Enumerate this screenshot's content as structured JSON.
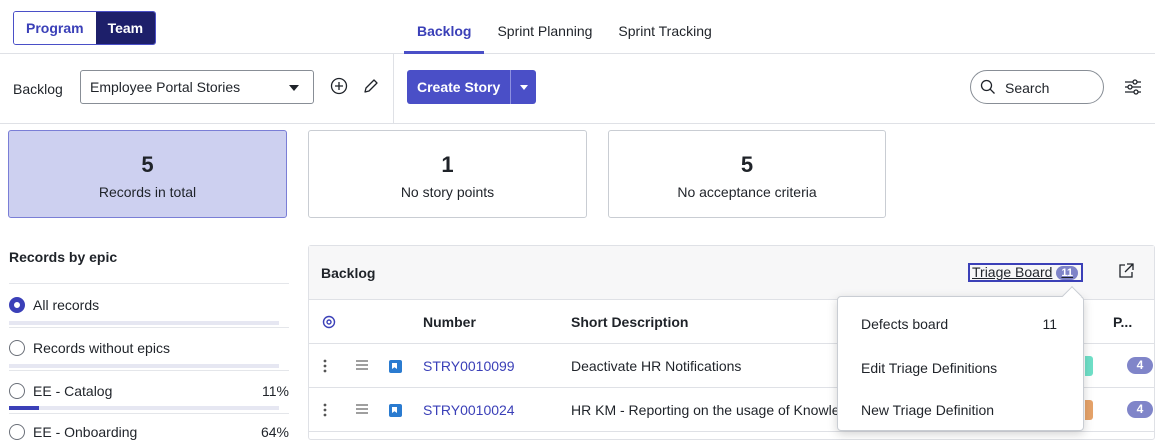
{
  "header": {
    "toggle": [
      {
        "label": "Program",
        "active": false
      },
      {
        "label": "Team",
        "active": true
      }
    ],
    "tabs": [
      {
        "label": "Backlog",
        "active": true
      },
      {
        "label": "Sprint Planning",
        "active": false
      },
      {
        "label": "Sprint Tracking",
        "active": false
      }
    ]
  },
  "toolbar": {
    "backlog_label": "Backlog",
    "selected_backlog": "Employee Portal Stories",
    "create_label": "Create Story",
    "search_placeholder": "Search"
  },
  "metrics": [
    {
      "value": "5",
      "label": "Records in total",
      "selected": true
    },
    {
      "value": "1",
      "label": "No story points",
      "selected": false
    },
    {
      "value": "5",
      "label": "No acceptance criteria",
      "selected": false
    }
  ],
  "epics": {
    "title": "Records by epic",
    "items": [
      {
        "label": "All records",
        "percent": "",
        "fill": 0,
        "selected": true
      },
      {
        "label": "Records without epics",
        "percent": "",
        "fill": 0,
        "selected": false
      },
      {
        "label": "EE - Catalog",
        "percent": "11%",
        "fill": 0.11,
        "selected": false
      },
      {
        "label": "EE - Onboarding",
        "percent": "64%",
        "fill": 0.64,
        "selected": false
      }
    ]
  },
  "backlog_table": {
    "title": "Backlog",
    "triage_label": "Triage Board",
    "triage_count": "11",
    "columns": {
      "number": "Number",
      "short_description": "Short Description",
      "priority": "P..."
    },
    "rows": [
      {
        "number": "STRY0010099",
        "short_description": "Deactivate HR Notifications",
        "state_color": "#6fe0c8",
        "priority": "4"
      },
      {
        "number": "STRY0010024",
        "short_description": "HR KM - Reporting on the usage of Knowledge",
        "state_color": "#e6a36a",
        "priority": "4"
      }
    ]
  },
  "triage_menu": {
    "items": [
      {
        "label": "Defects board",
        "count": "11"
      },
      {
        "label": "Edit Triage Definitions"
      },
      {
        "label": "New Triage Definition"
      }
    ]
  },
  "colors": {
    "accent": "#4a4fc7",
    "accent_dark": "#1d1f6a",
    "link": "#3b40b8",
    "selected_card": "#cdd0f0"
  }
}
